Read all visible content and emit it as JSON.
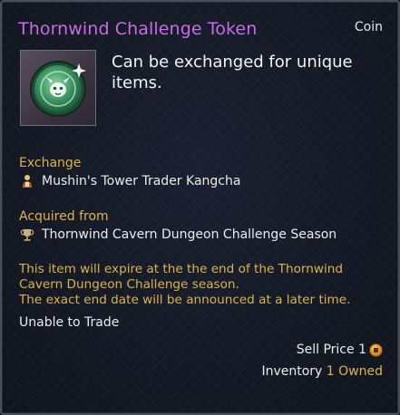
{
  "item": {
    "name": "Thornwind Challenge Token",
    "category": "Coin",
    "description": "Can be exchanged for unique items.",
    "icon": "thornwind-token-icon"
  },
  "colors": {
    "title": "#c96be6",
    "gold_text": "#ddb34b",
    "body_text": "#ececec",
    "background": "#141926",
    "border": "#4a4e58"
  },
  "exchange": {
    "label": "Exchange",
    "icon": "merchant-icon",
    "value": "Mushin's Tower Trader Kangcha"
  },
  "acquired": {
    "label": "Acquired from",
    "icon": "trophy-icon",
    "value": "Thornwind Cavern Dungeon Challenge Season"
  },
  "expiry": {
    "line1": "This item will expire at the the end of the Thornwind",
    "line2": "Cavern Dungeon Challenge season.",
    "line3": "The exact end date will be announced at a later time."
  },
  "trade_status": "Unable to Trade",
  "sell": {
    "label": "Sell Price",
    "value": "1",
    "icon": "coin-icon"
  },
  "inventory": {
    "label": "Inventory",
    "owned": "1 Owned"
  }
}
